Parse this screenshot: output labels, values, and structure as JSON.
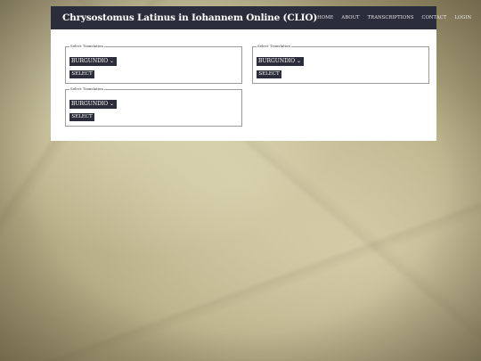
{
  "header": {
    "title": "Chrysostomus Latinus in Iohannem Online (CLIO)",
    "nav": [
      "HOME",
      "ABOUT",
      "TRANSCRIPTIONS",
      "CONTACT",
      "LOGIN"
    ]
  },
  "panels": [
    {
      "legend": "Select Translation",
      "selected": "BURGUNDIO",
      "button": "SELECT"
    },
    {
      "legend": "Select Translation",
      "selected": "BURGUNDIO",
      "button": "SELECT"
    },
    {
      "legend": "Select Translation",
      "selected": "BURGUNDIO",
      "button": "SELECT"
    }
  ],
  "colors": {
    "navbar": "#2b2d3a",
    "content_background": "#ffffff"
  }
}
